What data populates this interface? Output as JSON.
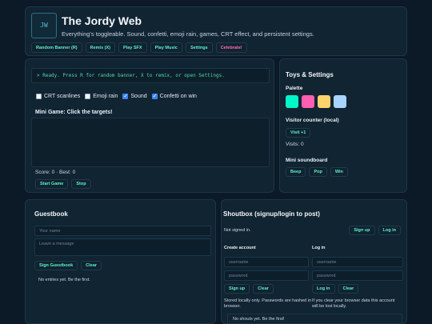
{
  "header": {
    "logo": "JW",
    "title": "The Jordy Web",
    "subtitle": "Everything's toggleable. Sound, confetti, emoji rain, games, CRT effect, and persistent settings.",
    "buttons": [
      "Random Banner (R)",
      "Remix (X)",
      "Play SFX",
      "Play Music",
      "Settings",
      "Celebrate!"
    ]
  },
  "console": {
    "text": "> Ready. Press R for random banner, X to remix, or open Settings."
  },
  "toggles": [
    {
      "label": "CRT scanlines",
      "checked": false
    },
    {
      "label": "Emoji rain",
      "checked": false
    },
    {
      "label": "Sound",
      "checked": true
    },
    {
      "label": "Confetti on win",
      "checked": true
    }
  ],
  "game": {
    "title": "Mini Game: Click the targets!",
    "score_text": "Score: 0 · Best: 0",
    "start_label": "Start Game",
    "stop_label": "Stop"
  },
  "side": {
    "title": "Toys & Settings",
    "palette_label": "Palette",
    "palette_colors": [
      "#00f5c8",
      "#ff5fb0",
      "#ffd36b",
      "#a8d4ff"
    ],
    "visitor_label": "Visitor counter (local)",
    "visit_button": "Visit +1",
    "visits_text": "Visits: 0",
    "soundboard_label": "Mini soundboard",
    "sound_buttons": [
      "Beep",
      "Pop",
      "Win"
    ]
  },
  "guestbook": {
    "title": "Guestbook",
    "name_placeholder": "Your name",
    "message_placeholder": "Leave a message",
    "sign_label": "Sign Guestbook",
    "clear_label": "Clear",
    "empty_text": "No entries yet. Be the first."
  },
  "shoutbox": {
    "title": "Shoutbox (signup/login to post)",
    "status": "Not signed in.",
    "signup_top": "Sign up",
    "login_top": "Log in",
    "create_label": "Create account",
    "login_label": "Log in",
    "username_placeholder": "username",
    "password_placeholder": "password",
    "signup_btn": "Sign up",
    "clear_btn": "Clear",
    "login_btn": "Log in",
    "note_left": "Stored locally only. Passwords are hashed in browser.",
    "note_right": "If you clear your browser data this account will be lost locally.",
    "empty_text": "No shouts yet. Be the first!"
  }
}
